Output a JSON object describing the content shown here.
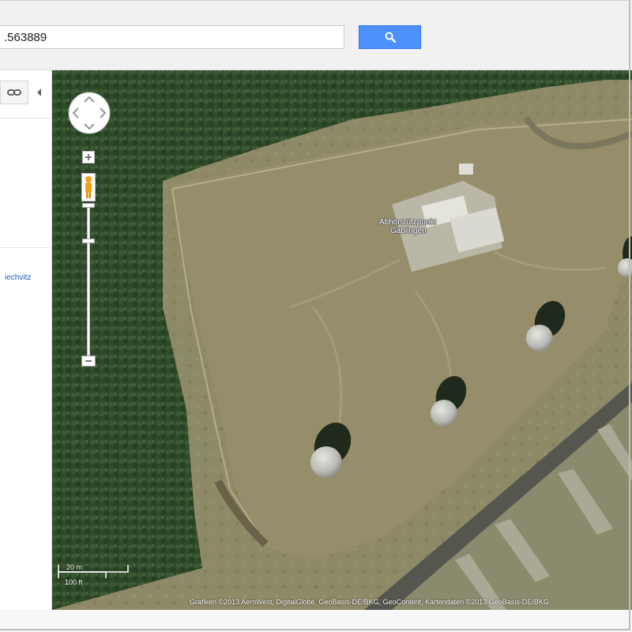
{
  "search": {
    "value": ".563889",
    "button_icon": "search-icon",
    "button_color": "#4d90fe"
  },
  "sidebar": {
    "link_button_icon": "link-icon",
    "collapse_icon": "chevron-left-icon",
    "link_text": "iechvitz"
  },
  "map": {
    "place_label_line1": "Abhörstützpunkt",
    "place_label_line2": "Gablingen",
    "scale_top": "20 m",
    "scale_bottom": "100 ft",
    "attribution": "Grafiken ©2013 AeroWest, DigitalGlobe, GeoBasis-DE/BKG, GeoContent, Kartendaten ©2013 GeoBasis-DE/BKG",
    "controls": {
      "pan_icon": "pan-control-icon",
      "zoom_in_icon": "plus-icon",
      "zoom_out_icon": "minus-icon",
      "pegman_icon": "pegman-icon"
    }
  }
}
